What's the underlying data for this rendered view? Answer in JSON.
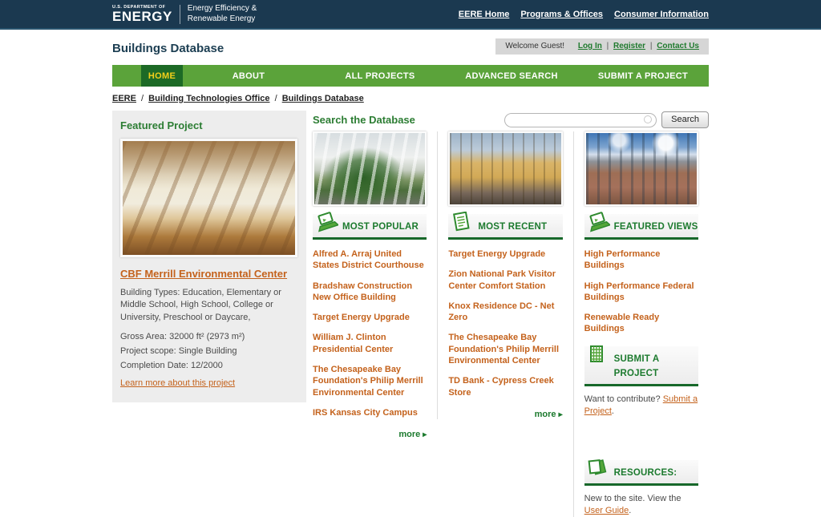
{
  "colors": {
    "navy": "#1b3950",
    "nav_green": "#5ba33a",
    "active_green": "#1d6a26",
    "active_gold": "#f4d01a",
    "heading_green": "#2c7d33",
    "section_border_green": "#17682a",
    "link_orange": "#c4621c",
    "panel_gray": "#ededed"
  },
  "topbar": {
    "dept_small": "U.S. DEPARTMENT OF",
    "dept_name": "ENERGY",
    "program_line1": "Energy Efficiency &",
    "program_line2": "Renewable Energy",
    "links": [
      {
        "label": "EERE Home"
      },
      {
        "label": "Programs & Offices"
      },
      {
        "label": "Consumer Information"
      }
    ]
  },
  "masthead": {
    "title": "Buildings Database",
    "welcome": "Welcome Guest!",
    "link_separator": "|",
    "links": [
      {
        "label": "Log In"
      },
      {
        "label": "Register"
      },
      {
        "label": "Contact Us"
      }
    ]
  },
  "nav": {
    "items": [
      {
        "label": "HOME",
        "active": true
      },
      {
        "label": "ABOUT",
        "active": false
      },
      {
        "label": "ALL PROJECTS",
        "active": false
      },
      {
        "label": "ADVANCED SEARCH",
        "active": false
      },
      {
        "label": "SUBMIT A PROJECT",
        "active": false
      }
    ]
  },
  "breadcrumb": {
    "separator": "/",
    "items": [
      {
        "label": "EERE"
      },
      {
        "label": "Building Technologies Office"
      },
      {
        "label": "Buildings Database"
      }
    ]
  },
  "featured_project": {
    "heading": "Featured Project",
    "title": "CBF Merrill Environmental Center",
    "building_types": "Building Types: Education, Elementary or Middle School, High School, College or University, Preschool or Daycare,",
    "gross_area": "Gross Area: 32000 ft² (2973 m²)",
    "project_scope": "Project scope: Single Building",
    "completion_date": "Completion Date: 12/2000",
    "learn_more": "Learn more about this project"
  },
  "search": {
    "heading": "Search the Database",
    "input_value": "",
    "button_label": "Search"
  },
  "columns": {
    "most_popular": {
      "title": "MOST POPULAR",
      "icon": "laptop-icon",
      "items": [
        {
          "label": "Alfred A. Arraj United States District Courthouse"
        },
        {
          "label": "Bradshaw Construction New Office Building"
        },
        {
          "label": "Target Energy Upgrade"
        },
        {
          "label": "William J. Clinton Presidential Center"
        },
        {
          "label": "The Chesapeake Bay Foundation's Philip Merrill Environmental Center"
        },
        {
          "label": "IRS Kansas City Campus"
        }
      ],
      "more_label": "more",
      "more_arrow": "▸"
    },
    "most_recent": {
      "title": "MOST RECENT",
      "icon": "document-icon",
      "items": [
        {
          "label": "Target Energy Upgrade"
        },
        {
          "label": "Zion National Park Visitor Center Comfort Station"
        },
        {
          "label": "Knox Residence DC - Net Zero"
        },
        {
          "label": "The Chesapeake Bay Foundation's Philip Merrill Environmental Center"
        },
        {
          "label": "TD Bank - Cypress Creek Store"
        }
      ],
      "more_label": "more",
      "more_arrow": "▸"
    },
    "featured_views": {
      "title": "FEATURED VIEWS",
      "icon": "laptop-icon",
      "items": [
        {
          "label": "High Performance Buildings"
        },
        {
          "label": "High Performance Federal Buildings"
        },
        {
          "label": "Renewable Ready Buildings"
        }
      ]
    },
    "submit_project": {
      "title": "SUBMIT A PROJECT",
      "icon": "building-icon",
      "text_prefix": "Want to contribute? ",
      "link_label": "Submit a Project",
      "text_suffix": "."
    },
    "resources": {
      "title": "RESOURCES:",
      "icon": "papers-icon",
      "text_prefix": "New to the site. View the ",
      "link_label": "User Guide",
      "text_suffix": "."
    }
  }
}
